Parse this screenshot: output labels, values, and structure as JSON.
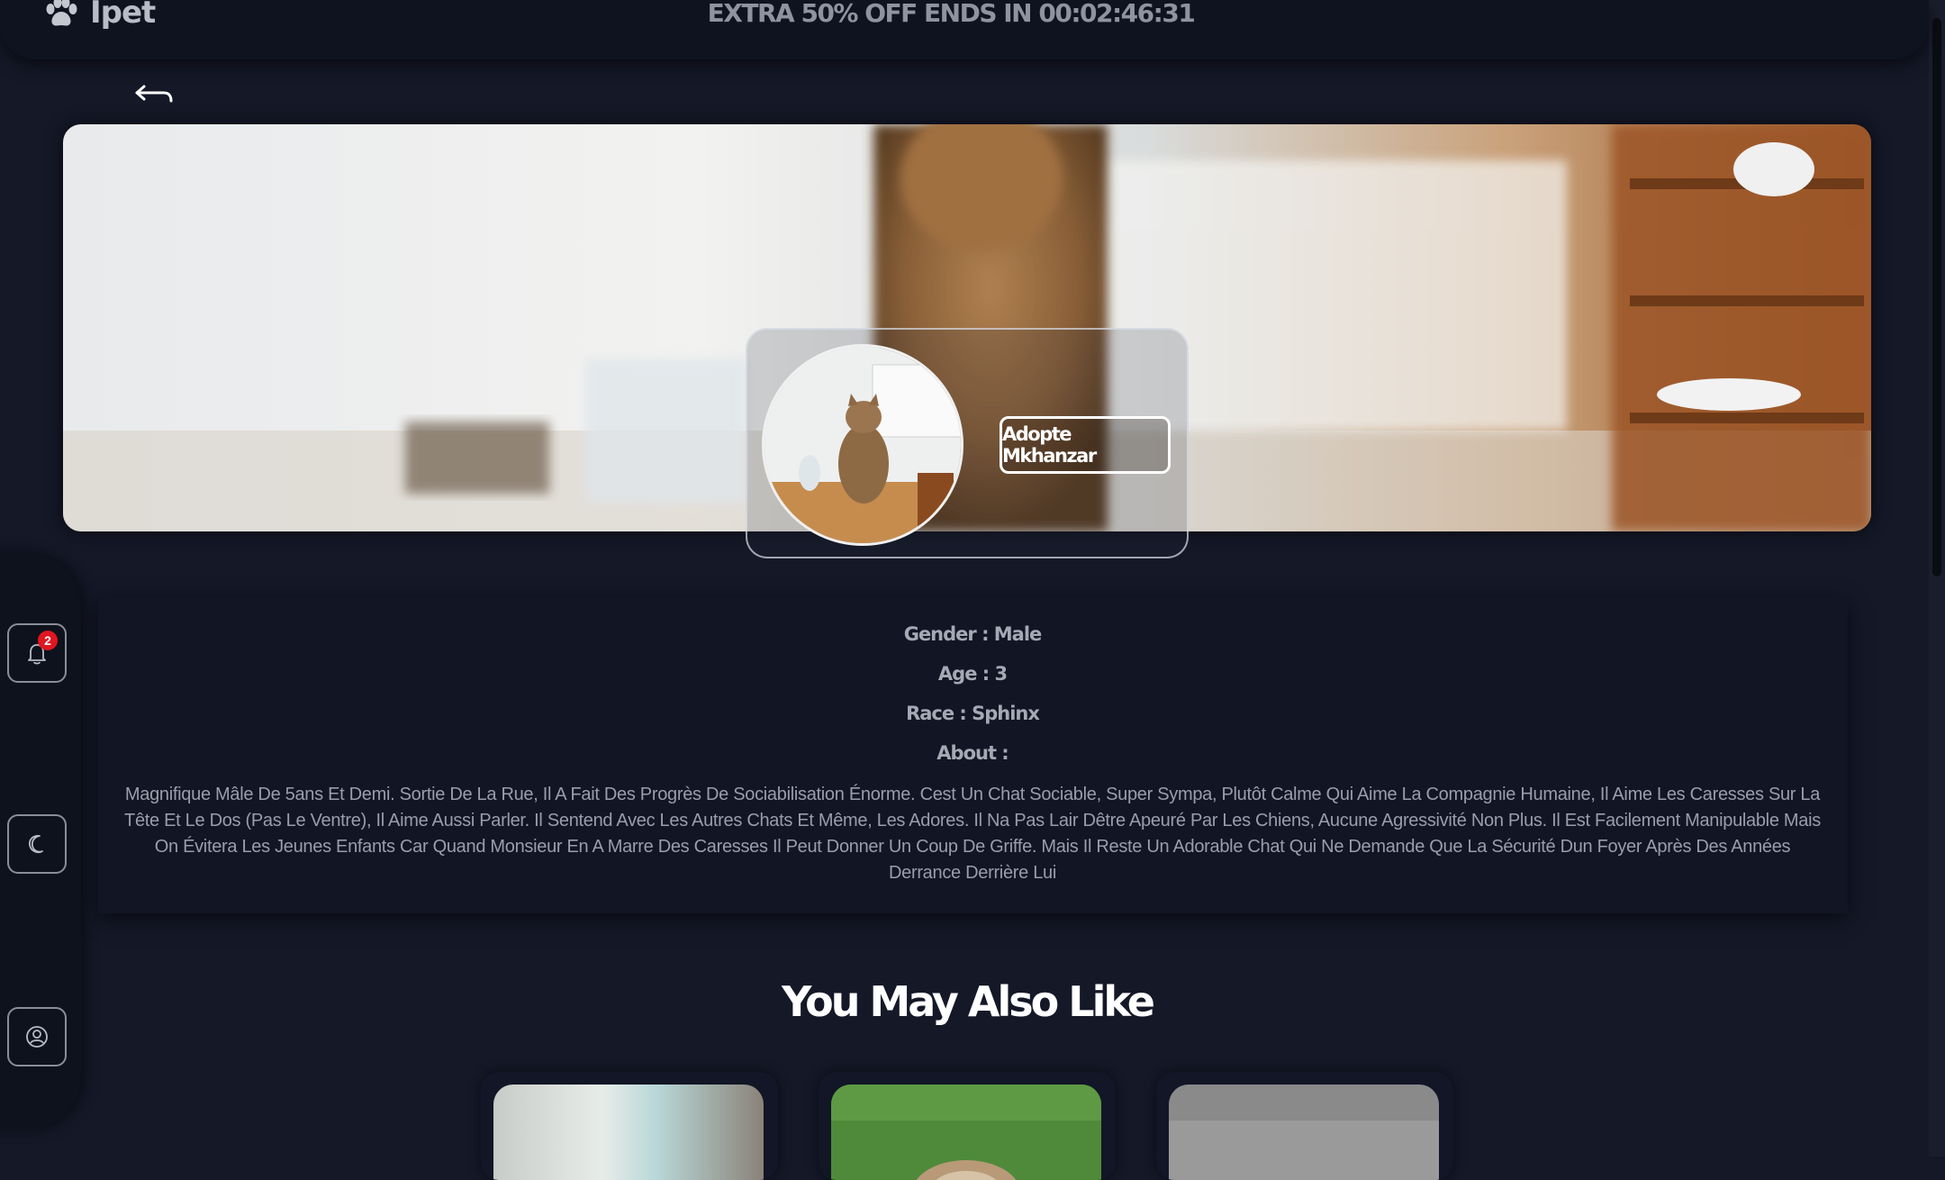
{
  "header": {
    "brand_name": "Ipet",
    "brand_icon": "paw-icon",
    "promo": "EXTRA 50% OFF ENDS IN 00:02:46:31"
  },
  "navigation": {
    "back_icon": "back-arrow-icon"
  },
  "profile": {
    "adopt_label": "Adopte Mkhanzar"
  },
  "sidebar": {
    "notification_icon": "bell-icon",
    "notification_count": "2",
    "theme_icon": "moon-icon",
    "profile_icon": "user-icon"
  },
  "details": {
    "gender": "Gender : Male",
    "age": "Age : 3",
    "race": "Race : Sphinx",
    "about_label": "About :",
    "about_text": "Magnifique Mâle De 5ans Et Demi. Sortie De La Rue, Il A Fait Des Progrès De Sociabilisation Énorme. Cest Un Chat Sociable, Super Sympa, Plutôt Calme Qui Aime La Compagnie Humaine, Il Aime Les Caresses Sur La Tête Et Le Dos (Pas Le Ventre), Il Aime Aussi Parler. Il Sentend Avec Les Autres Chats Et Même, Les Adores. Il Na Pas Lair Dêtre Apeuré Par Les Chiens, Aucune Agressivité Non Plus. Il Est Facilement Manipulable Mais On Évitera Les Jeunes Enfants Car Quand Monsieur En A Marre Des Caresses Il Peut Donner Un Coup De Griffe. Mais Il Reste Un Adorable Chat Qui Ne Demande Que La Sécurité Dun Foyer Après Des Années Derrance Derrière Lui"
  },
  "suggestions": {
    "title": "You May Also Like"
  },
  "colors": {
    "background": "#141827",
    "panel": "#111524",
    "badge": "#e01620"
  }
}
